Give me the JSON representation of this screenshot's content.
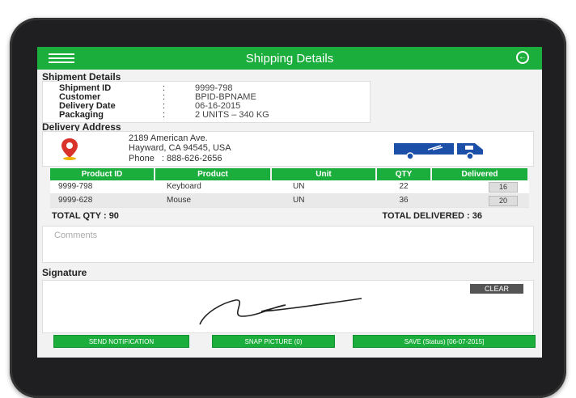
{
  "appbar": {
    "title": "Shipping Details",
    "menu_icon": "menu-icon",
    "back_icon": "back-arrow-icon"
  },
  "shipment": {
    "title": "Shipment Details",
    "rows": [
      {
        "label": "Shipment ID",
        "colon": ":",
        "value": "9999-798"
      },
      {
        "label": "Customer",
        "colon": ":",
        "value": "BPID-BPNAME"
      },
      {
        "label": "Delivery Date",
        "colon": ":",
        "value": "06-16-2015"
      },
      {
        "label": "Packaging",
        "colon": ":",
        "value": "2 UNITS – 340 KG"
      }
    ]
  },
  "delivery": {
    "title": "Delivery Address",
    "line1": "2189 American Ave.",
    "line2": "Hayward, CA 94545, USA",
    "phone_label": "Phone",
    "phone_value": ": 888-626-2656",
    "location_icon": "location-pin-icon",
    "truck_icon": "delivery-truck-icon"
  },
  "table": {
    "headers": [
      "Product ID",
      "Product",
      "Unit",
      "QTY",
      "Delivered"
    ],
    "rows": [
      {
        "id": "9999-798",
        "product": "Keyboard",
        "unit": "UN",
        "qty": "22",
        "delivered": "16"
      },
      {
        "id": "9999-628",
        "product": "Mouse",
        "unit": "UN",
        "qty": "36",
        "delivered": "20"
      }
    ]
  },
  "totals": {
    "qty": "TOTAL QTY : 90",
    "delivered": "TOTAL DELIVERED : 36"
  },
  "comments": {
    "placeholder": "Comments"
  },
  "signature": {
    "label": "Signature",
    "clear": "CLEAR"
  },
  "actions": {
    "notify": "SEND NOTIFICATION",
    "snap": "SNAP PICTURE (0)",
    "save": "SAVE (Status) [06-07-2015]"
  },
  "colors": {
    "accent": "#1cae3c",
    "pin": "#d9342b",
    "truck": "#1b4fa8"
  }
}
